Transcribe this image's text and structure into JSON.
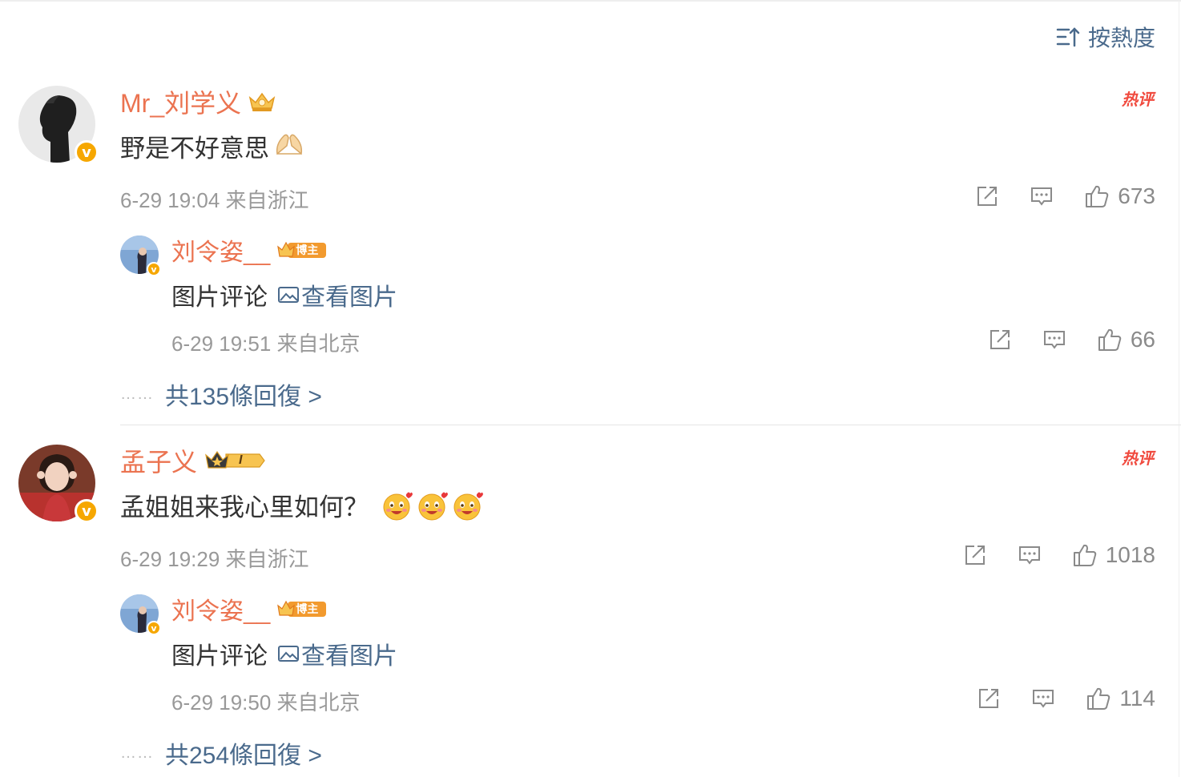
{
  "sort": {
    "label": "按熱度"
  },
  "comments": [
    {
      "user": "Mr_刘学义",
      "text": "野是不好意思",
      "meta": "6-29 19:04 来自浙江",
      "hot": "热评",
      "likes": "673",
      "reply": {
        "user": "刘令姿__",
        "badge": "博主",
        "text": "图片评论",
        "link": "查看图片",
        "meta": "6-29 19:51 来自北京",
        "likes": "66"
      },
      "more": {
        "dots": "……",
        "label": "共135條回復 >"
      }
    },
    {
      "user": "孟子义",
      "text": "孟姐姐来我心里如何？",
      "meta": "6-29 19:29 来自浙江",
      "hot": "热评",
      "likes": "1018",
      "level_badge": "I",
      "reply": {
        "user": "刘令姿__",
        "badge": "博主",
        "text": "图片评论",
        "link": "查看图片",
        "meta": "6-29 19:50 来自北京",
        "likes": "114"
      },
      "more": {
        "dots": "……",
        "label": "共254條回復 >"
      }
    }
  ],
  "colors": {
    "username": "#eb7350",
    "link": "#4a6a8c",
    "meta": "#999999",
    "hot": "#f04a3e",
    "verified": "#f6a700"
  },
  "icons": [
    "sort-icon",
    "crown-icon",
    "verified-icon",
    "share-icon",
    "comment-icon",
    "like-icon",
    "image-icon",
    "emoji-hands",
    "emoji-heart-face"
  ]
}
